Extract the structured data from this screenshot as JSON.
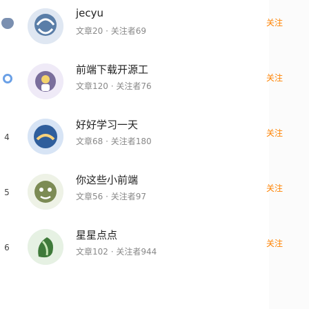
{
  "users": [
    {
      "rank": "",
      "rank_style": "medal",
      "name": "jecyu",
      "meta": "文章20 · 关注者69",
      "follow_label": "关注",
      "avatar_color": "#5a7ea8"
    },
    {
      "rank": "",
      "rank_style": "badge",
      "name": "前端下载开源工",
      "meta": "文章120 · 关注者76",
      "follow_label": "关注",
      "avatar_color": "#7a6e9c"
    },
    {
      "rank": "4",
      "rank_style": "number",
      "name": "好好学习一天",
      "meta": "文章68 · 关注者180",
      "follow_label": "关注",
      "avatar_color": "#2f5e9c"
    },
    {
      "rank": "5",
      "rank_style": "number",
      "name": "你这些小前端",
      "meta": "文章56 · 关注者97",
      "follow_label": "关注",
      "avatar_color": "#7c8b54"
    },
    {
      "rank": "6",
      "rank_style": "number",
      "name": "星星点点",
      "meta": "文章102 · 关注者944",
      "follow_label": "关注",
      "avatar_color": "#3f7a3a"
    }
  ]
}
